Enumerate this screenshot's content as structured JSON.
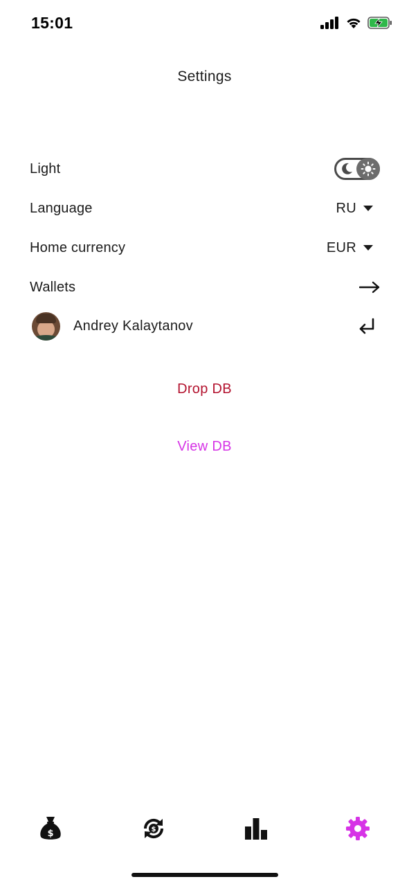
{
  "status_bar": {
    "time": "15:01",
    "icons": [
      "signal-icon",
      "wifi-icon",
      "battery-charging-icon"
    ],
    "battery_color": "#2fb84a"
  },
  "header": {
    "title": "Settings"
  },
  "settings": {
    "theme": {
      "label": "Light",
      "toggle_state": "light",
      "icons": [
        "moon-icon",
        "sun-icon"
      ]
    },
    "language": {
      "label": "Language",
      "value": "RU"
    },
    "currency": {
      "label": "Home currency",
      "value": "EUR"
    },
    "wallets": {
      "label": "Wallets",
      "icon": "arrow-right-icon"
    },
    "user": {
      "name": "Andrey Kalaytanov",
      "icon": "logout-return-icon"
    }
  },
  "actions": {
    "drop_db": "Drop DB",
    "view_db": "View DB",
    "drop_color": "#b3122e",
    "view_color": "#d633e6"
  },
  "bottom_nav": {
    "items": [
      {
        "name": "money-bag-icon",
        "active": false
      },
      {
        "name": "currency-exchange-icon",
        "active": false
      },
      {
        "name": "bar-chart-icon",
        "active": false
      },
      {
        "name": "gear-icon",
        "active": true
      }
    ],
    "active_color": "#d633e6",
    "inactive_color": "#111111"
  }
}
